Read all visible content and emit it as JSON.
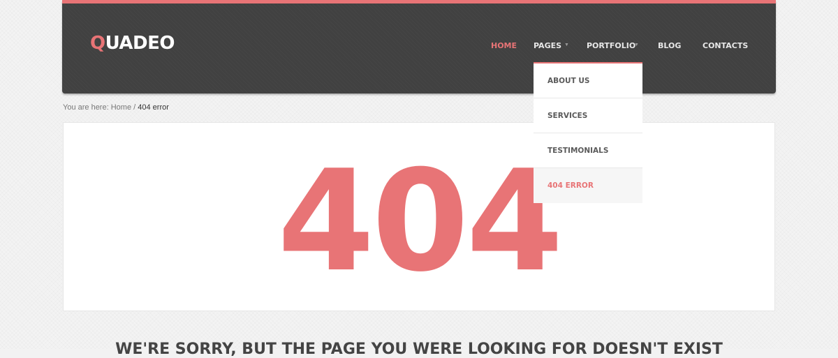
{
  "brand": {
    "logo_first": "Q",
    "logo_rest": "UADEO"
  },
  "nav": {
    "items": [
      {
        "label": "Home",
        "active": true
      },
      {
        "label": "Pages",
        "has_dropdown": true
      },
      {
        "label": "Portfolio",
        "has_dropdown": true
      },
      {
        "label": "Blog"
      },
      {
        "label": "Contacts"
      }
    ]
  },
  "dropdown": {
    "items": [
      "About us",
      "Services",
      "Testimonials",
      "404 Error"
    ],
    "current": "404 Error"
  },
  "breadcrumb": {
    "prefix": "You are here:",
    "home": "Home",
    "separator": "/",
    "current": "404 error"
  },
  "error": {
    "code": "404",
    "message": "We're sorry, but the page you were looking for doesn't exist"
  },
  "colors": {
    "accent": "#e87476",
    "header_bg": "#414141"
  },
  "icons": {
    "dropdown_caret": "chevron-down-icon"
  }
}
